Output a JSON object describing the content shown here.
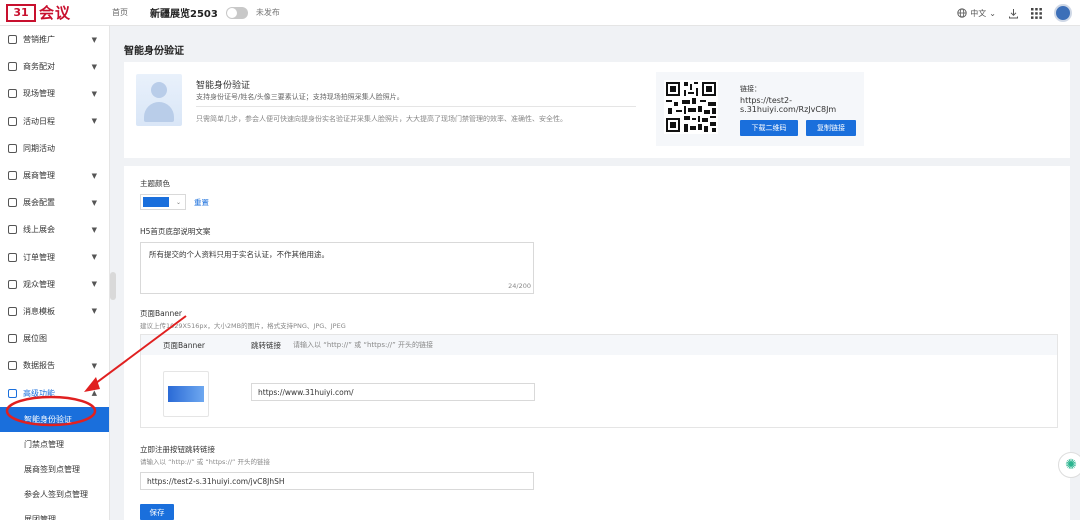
{
  "topbar": {
    "logo_mark": "31",
    "logo_text": "会议",
    "home": "首页",
    "expo_name": "新疆展览2503",
    "publish_status": "未发布",
    "language": "中文",
    "icons": [
      "globe-icon",
      "download-icon",
      "apps-grid-icon",
      "avatar"
    ]
  },
  "sidebar": {
    "items": [
      {
        "label": "营销推广",
        "icon": "megaphone-icon"
      },
      {
        "label": "商务配对",
        "icon": "handshake-icon"
      },
      {
        "label": "现场管理",
        "icon": "video-icon"
      },
      {
        "label": "活动日程",
        "icon": "calendar-icon"
      },
      {
        "label": "同期活动",
        "icon": "document-icon"
      },
      {
        "label": "展商管理",
        "icon": "store-icon"
      },
      {
        "label": "展会配置",
        "icon": "settings-icon"
      },
      {
        "label": "线上展会",
        "icon": "monitor-icon"
      },
      {
        "label": "订单管理",
        "icon": "order-icon"
      },
      {
        "label": "观众管理",
        "icon": "user-icon"
      },
      {
        "label": "消息模板",
        "icon": "bell-icon"
      },
      {
        "label": "展位图",
        "icon": "map-icon"
      },
      {
        "label": "数据报告",
        "icon": "chart-icon"
      },
      {
        "label": "高级功能",
        "icon": "grid-icon"
      }
    ],
    "sub_items": [
      "智能身份验证",
      "门禁点管理",
      "展商签到点管理",
      "参会人签到点管理",
      "展团管理"
    ]
  },
  "page": {
    "title": "智能身份验证",
    "feature_title": "智能身份验证",
    "feature_desc": "支持身份证号/姓名/头像三要素认证；支持现场拍照采集人脸照片。",
    "feature_long": "只需简单几步，参会人便可快速向提身份实名验证并采集人脸照片，大大提高了现场门禁管理的效率、准确性、安全性。",
    "link_label": "链接：",
    "link_value": "https://test2-s.31huiyi.com/RzJvC8Jm",
    "download_qr": "下载二维码",
    "copy_link": "复制链接"
  },
  "form": {
    "theme_color_label": "主题颜色",
    "theme_color_value": "#1a6fdc",
    "reset": "重置",
    "h5_label": "H5首页底部说明文案",
    "h5_text": "所有提交的个人资料只用于实名认证，不作其他用途。",
    "h5_counter": "24/200",
    "banner_label": "页面Banner",
    "banner_hint": "建议上传1029X516px，大小2MB的图片，格式支持PNG、JPG、JPEG",
    "banner_col_1": "页面Banner",
    "banner_col_2": "跳转链接",
    "banner_col_2_hint": "请输入以 “http://” 或 “https://” 开头的链接",
    "banner_url": "https://www.31huiyi.com/",
    "register_label": "立即注册按钮跳转链接",
    "register_hint": "请输入以 “http://” 或 “https://” 开头的链接",
    "register_url": "https://test2-s.31huiyi.com/jvC8JhSH",
    "save": "保存"
  },
  "colors": {
    "accent": "#1a6fdc",
    "brand": "#c8102e",
    "annotation": "#e02020"
  }
}
